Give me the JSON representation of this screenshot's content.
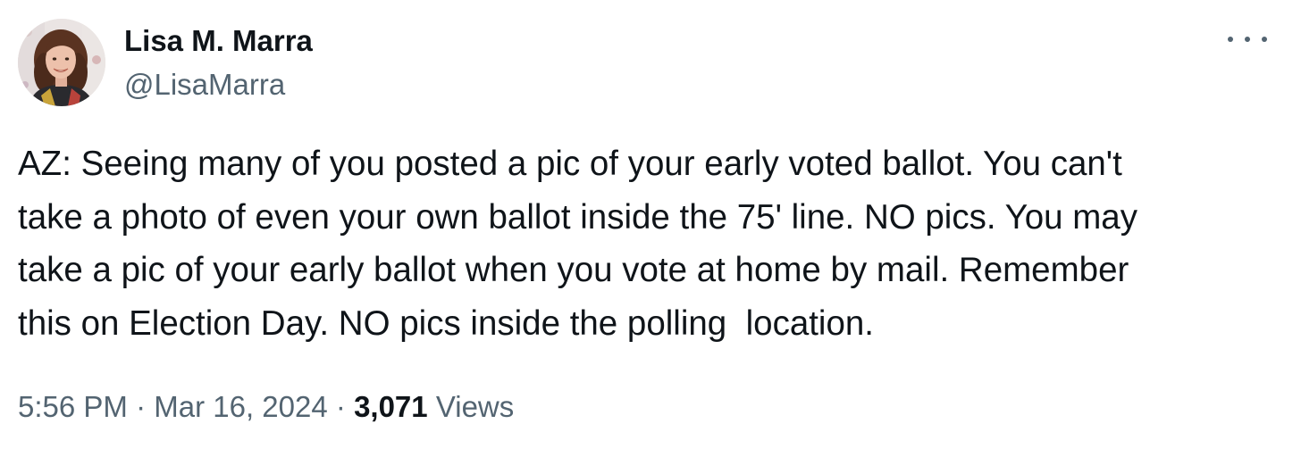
{
  "author": {
    "name": "Lisa M. Marra",
    "handle": "@LisaMarra",
    "avatar": "profile-photo"
  },
  "more_icon": "more-horizontal-icon",
  "tweet": {
    "text": "AZ: Seeing many of you posted a pic of your early voted ballot. You can't\ntake a photo of even your own ballot inside the 75' line. NO pics. You may\ntake a pic of your early ballot when you vote at home by mail. Remember\nthis on Election Day. NO pics inside the polling  location.",
    "time": "5:56 PM",
    "separator": "·",
    "date": "Mar 16, 2024",
    "views_count": "3,071",
    "views_label": "Views"
  },
  "colors": {
    "primary_text": "#0f1419",
    "secondary_text": "#536471",
    "background": "#ffffff"
  }
}
